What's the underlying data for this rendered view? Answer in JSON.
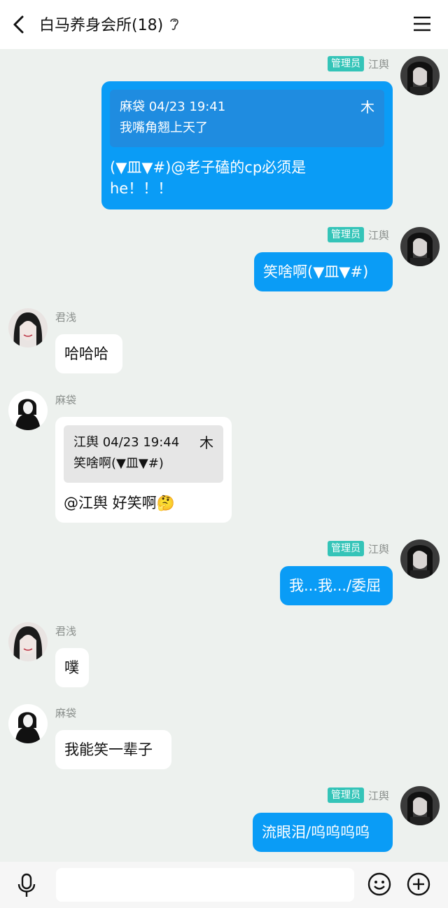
{
  "header": {
    "title": "白马养身会所(18)",
    "icons": {
      "back": "chevron-left-icon",
      "ear": "ear-icon",
      "menu": "hamburger-menu-icon"
    }
  },
  "admin_badge": "管理员",
  "messages": [
    {
      "sender": "江舆",
      "direction": "out",
      "admin": true,
      "quote": {
        "header": "麻袋 04/23 19:41",
        "text": "我嘴角翘上天了"
      },
      "lines": [
        "(▼皿▼#)@老子磕的cp必须是",
        "he！！！"
      ]
    },
    {
      "sender": "江舆",
      "direction": "out",
      "admin": true,
      "text": "笑啥啊(▼皿▼#)"
    },
    {
      "sender": "君浅",
      "direction": "in",
      "text": "哈哈哈"
    },
    {
      "sender": "麻袋",
      "direction": "in",
      "quote": {
        "header": "江舆 04/23 19:44",
        "text": "笑啥啊(▼皿▼#)"
      },
      "text": "@江舆 好笑啊🤔"
    },
    {
      "sender": "江舆",
      "direction": "out",
      "admin": true,
      "text": "我...我.../委屈"
    },
    {
      "sender": "君浅",
      "direction": "in",
      "text": "噗"
    },
    {
      "sender": "麻袋",
      "direction": "in",
      "text": "我能笑一辈子"
    },
    {
      "sender": "江舆",
      "direction": "out",
      "admin": true,
      "text": "流眼泪/呜呜呜呜"
    }
  ],
  "quote_pin_glyph": "⽊",
  "colors": {
    "bubble_out": "#0a9cf6",
    "badge": "#34c4b8",
    "background": "#edf1ee"
  },
  "bottom_bar": {
    "icons": [
      "microphone-icon",
      "emoji-icon",
      "plus-icon"
    ]
  }
}
